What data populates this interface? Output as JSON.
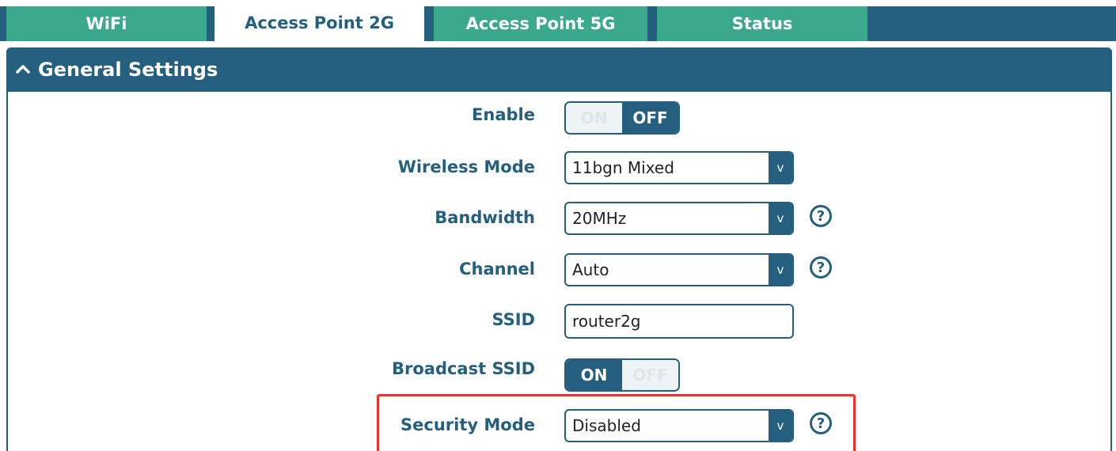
{
  "tabs": [
    {
      "label": "WiFi",
      "active": false
    },
    {
      "label": "Access Point 2G",
      "active": true
    },
    {
      "label": "Access Point 5G",
      "active": false
    },
    {
      "label": "Status",
      "active": false
    }
  ],
  "panel": {
    "title": "General Settings",
    "icon": "chevron-up-icon"
  },
  "fields": {
    "enable": {
      "label": "Enable",
      "on": "ON",
      "off": "OFF",
      "state": "OFF"
    },
    "wireless_mode": {
      "label": "Wireless Mode",
      "value": "11bgn Mixed",
      "arrow": "v"
    },
    "bandwidth": {
      "label": "Bandwidth",
      "value": "20MHz",
      "arrow": "v",
      "help": "?"
    },
    "channel": {
      "label": "Channel",
      "value": "Auto",
      "arrow": "v",
      "help": "?"
    },
    "ssid": {
      "label": "SSID",
      "value": "router2g"
    },
    "broadcast_ssid": {
      "label": "Broadcast SSID",
      "on": "ON",
      "off": "OFF",
      "state": "ON"
    },
    "security_mode": {
      "label": "Security Mode",
      "value": "Disabled",
      "arrow": "v",
      "help": "?"
    }
  },
  "colors": {
    "primary": "#24607e",
    "tab": "#3aa88c",
    "highlight": "#f0312b"
  }
}
